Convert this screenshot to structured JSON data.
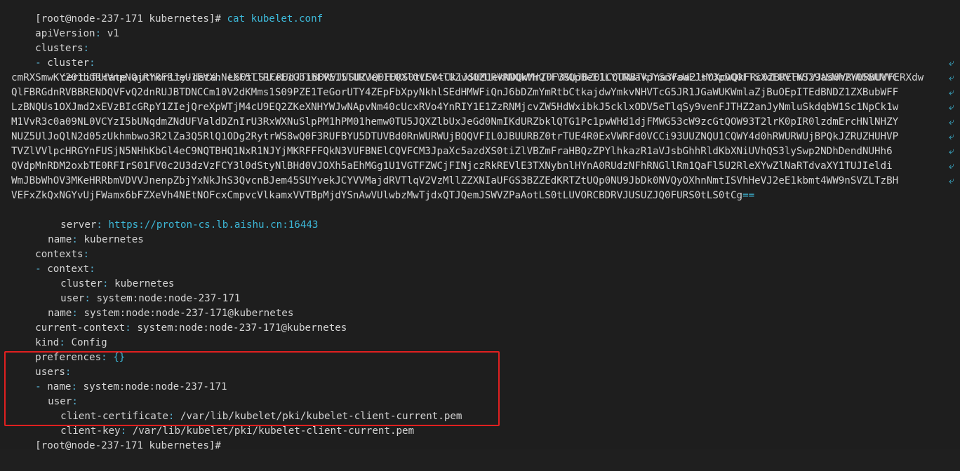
{
  "prompt": {
    "top": "[root@node-237-171 kubernetes]#",
    "command": "cat kubelet.conf",
    "bottom": "[root@node-237-171 kubernetes]#"
  },
  "config": {
    "api_version_key": "apiVersion",
    "api_version_val": "v1",
    "clusters_key": "clusters",
    "cluster_key": "cluster",
    "ca_data_key": "certificate-authority-data",
    "ca_data_first": "LS0tLS1CRUdJTiBDRVJUSUZJQ0FURS0tLS0tCk1JSUM1ekNDQWMrZ0F3SUJBZ0lCQURBTkJna3Foa2lHOXcwQkFRc0ZBREFWTVJNd0VRWURWUVFERXdw",
    "ca_data_lines": [
      "cmRXSmwKY201bGRHVnpNQjRYRFRJeU1EVXhNekF5TlRFeE1Gb1hEVE15TURVeE1EQXlOVEV4TUZvd0ZURVRNQkVHQTFVRQpBeE1LYTNWaVpYSnVaWFJsY3pDQ0FTSXdEUVlKS29aSWh2Y05BUVVC",
      "QlFBRGdnRVBBRENDQVFvQ2dnRUJBTDNCCm10V2dKMms1S09PZE1TeGorUTY4ZEpFbXpyNkhlSEdHMWFiQnJ6bDZmYmRtbCtkajdwYmkvNHVTcG5JR1JGaWUKWmlaZjBuOEpITEdBNDZ1ZXBubWFF",
      "LzBNQUs1OXJmd2xEVzBIcGRpY1ZIejQreXpWTjM4cU9EQ2ZKeXNHYWJwNApvNm40cUcxRVo4YnRIY1E1ZzRNMjcvZW5HdWxibkJ5cklxODV5eTlqSy9venFJTHZ2anJyNmluSkdqbW1Sc1NpCk1w",
      "M1VvR3c0a09NL0VCYzI5bUNqdmZNdUFValdDZnIrU3RxWXNuSlpPM1hPM01hemw0TU5JQXZlbUxJeGd0NmIKdURZbklQTG1Pc1pwWHd1djFMWG53cW9zcGtQOW93T2lrK0pIR0lzdmErcHNlNHZY",
      "NUZ5UlJoQlN2d05zUkhmbwo3R2lZa3Q5RlQ1ODg2RytrWS8wQ0F3RUFBYU5DTUVBd0RnWURWUjBQQVFIL0JBUURBZ0trTUE4R0ExVWRFd0VCCi93UUZNQU1CQWY4d0hRWURWUjBPQkJZRUZHUHVP",
      "TVZlVVlpcHRGYnFUSjN5NHhKbGl4eC9NQTBHQ1NxR1NJYjMKRFFFQkN3VUFBNElCQVFCM3JpaXc5azdXS0tiZlVBZmFraHBQzZPYlhkazR1aVJsbGhhRldKbXNiUVhQS3lySwp2NDhDendNUHh6",
      "QVdpMnRDM2oxbTE0RFIrS01FV0c2U3dzVzFCY3l0dStyNlBHd0VJOXh5aEhMGg1U1VGTFZWCjFINjczRkREVlE3TXNybnlHYnA0RUdzNFhRNGllRm1QaFl5U2RleXYwZlNaRTdvaXY1TUJIeldi",
      "WmJBbWhOV3MKeHRRbmVDVVJnenpZbjYxNkJhS3QvcnBJem45SUYvekJCYVVMajdRVTlqV2VzMllZZXNIaUFGS3BZZEdKRTZtUQp0NU9JbDk0NVQyOXhnNmtISVhHeVJ2eE1kbmt4WW9nSVZLTzBH",
      "VEFxZkQxNGYvUjFWamx6bFZXeVh4NEtNOFcxCmpvcVlkamxVVTBpMjdYSnAwVUlwbzMwTjdxQTJQemJSWVZPaAotLS0tLUVORCBDRVJUSUZJQ0FURS0tLS0tCg=="
    ],
    "server_key": "server",
    "server_val": "https://proton-cs.lb.aishu.cn:16443",
    "name_key": "name",
    "cluster_name": "kubernetes",
    "contexts_key": "contexts",
    "context_key": "context",
    "ctx_cluster_val": "kubernetes",
    "user_key": "user",
    "ctx_user_val": "system:node:node-237-171",
    "ctx_name_val": "system:node:node-237-171@kubernetes",
    "current_context_key": "current-context",
    "current_context_val": "system:node:node-237-171@kubernetes",
    "kind_key": "kind",
    "kind_val": "Config",
    "preferences_key": "preferences",
    "preferences_val": "{}",
    "users_key": "users",
    "users_name_val": "system:node:node-237-171",
    "users_user_key": "user",
    "client_cert_key": "client-certificate",
    "client_cert_val": "/var/lib/kubelet/pki/kubelet-client-current.pem",
    "client_key_key": "client-key",
    "client_key_val": "/var/lib/kubelet/pki/kubelet-client-current.pem"
  },
  "colors": {
    "background": "#1e1e1e",
    "text": "#d4d4d4",
    "accent": "#3db8d8",
    "highlight_border": "#e02020",
    "cursor": "#f5b400"
  },
  "wrap_marker": "⤶",
  "ca_tail_marker": "=="
}
